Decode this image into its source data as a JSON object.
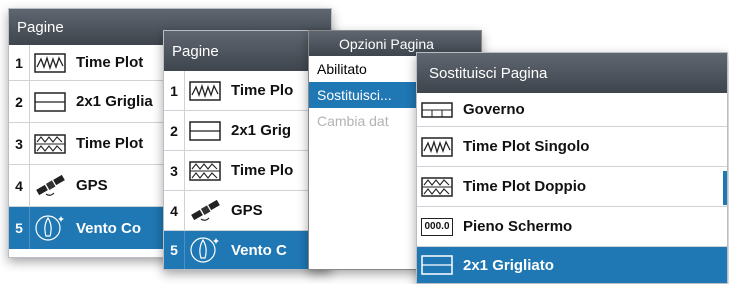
{
  "panel1": {
    "title": "Pagine",
    "items": [
      {
        "num": "1",
        "label": "Time Plot",
        "icon": "time-plot-single-icon"
      },
      {
        "num": "2",
        "label": "2x1 Griglia",
        "icon": "grid-2x1-icon"
      },
      {
        "num": "3",
        "label": "Time Plot",
        "icon": "time-plot-double-icon"
      },
      {
        "num": "4",
        "label": "GPS",
        "icon": "satellite-icon"
      },
      {
        "num": "5",
        "label": "Vento Co",
        "icon": "wind-icon"
      }
    ]
  },
  "panel2": {
    "title": "Pagine",
    "items": [
      {
        "num": "1",
        "label": "Time Plo",
        "icon": "time-plot-single-icon"
      },
      {
        "num": "2",
        "label": "2x1 Grig",
        "icon": "grid-2x1-icon"
      },
      {
        "num": "3",
        "label": "Time Plo",
        "icon": "time-plot-double-icon"
      },
      {
        "num": "4",
        "label": "GPS",
        "icon": "satellite-icon"
      },
      {
        "num": "5",
        "label": "Vento C",
        "icon": "wind-icon"
      }
    ]
  },
  "options_menu": {
    "title": "Opzioni Pagina",
    "items": [
      {
        "label": "Abilitato"
      },
      {
        "label": "Sostituisci..."
      },
      {
        "label": "Cambia dat"
      }
    ]
  },
  "replace_panel": {
    "title": "Sostituisci Pagina",
    "items": [
      {
        "label": "Governo",
        "icon": "steering-icon"
      },
      {
        "label": "Time Plot Singolo",
        "icon": "time-plot-single-icon"
      },
      {
        "label": "Time Plot Doppio",
        "icon": "time-plot-double-icon"
      },
      {
        "label": "Pieno Schermo",
        "icon": "full-screen-digital-icon"
      },
      {
        "label": "2x1 Grigliato",
        "icon": "grid-2x1-icon"
      }
    ],
    "full_screen_icon_text": "000.0"
  },
  "colors": {
    "selection": "#1f77b4",
    "header": "#4a5059"
  }
}
